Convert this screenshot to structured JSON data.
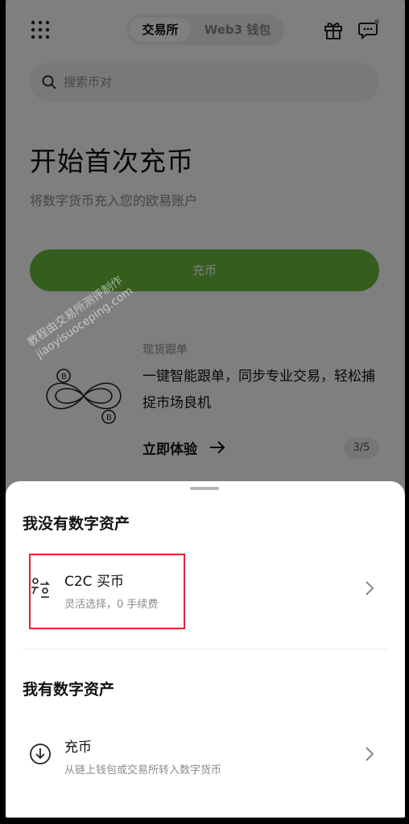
{
  "header": {
    "tabs": [
      {
        "label": "交易所",
        "active": true
      },
      {
        "label": "Web3 钱包",
        "active": false
      }
    ],
    "icons": [
      "grid-icon",
      "gift-icon",
      "chat-icon"
    ]
  },
  "search": {
    "placeholder": "搜索币对"
  },
  "hero": {
    "title": "开始首次充币",
    "subtitle": "将数字货币充入您的欧易账户",
    "button_label": "充币"
  },
  "promo": {
    "tag": "现货跟单",
    "text": "一键智能跟单，同步专业交易，轻松捕捉市场良机",
    "cta": "立即体验",
    "pager": "3/5"
  },
  "watermark": {
    "line1": "教程由交易所测评制作",
    "line2": "jiaoyisuoceping.com"
  },
  "sheet": {
    "section1_title": "我没有数字资产",
    "option1": {
      "title": "C2C 买币",
      "subtitle": "灵活选择，0 手续费",
      "icon": "c2c-exchange-icon"
    },
    "section2_title": "我有数字资产",
    "option2": {
      "title": "充币",
      "subtitle": "从链上钱包或交易所转入数字货币",
      "icon": "download-circle-icon"
    }
  },
  "colors": {
    "brand_green": "#6bbd3c",
    "highlight_red": "#e0242e"
  }
}
